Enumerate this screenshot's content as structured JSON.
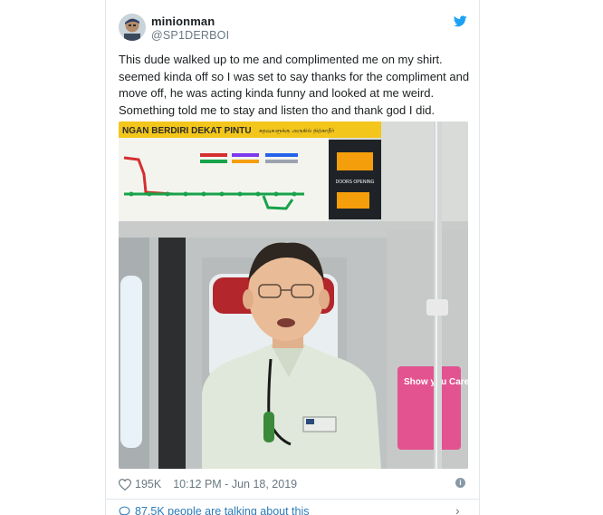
{
  "author": {
    "display_name": "minionman",
    "handle": "@SP1DERBOI"
  },
  "tweet": {
    "lines": [
      "This dude walked up to me and complimented me on my shirt.",
      "seemed kinda off so I was set to say thanks for the compliment and",
      "move off, he was acting kinda funny and looked at me weird.",
      "Something told me to stay and listen tho and thank god I did."
    ]
  },
  "photo": {
    "sign_text": "NGAN BERDIRI DEKAT PINTU",
    "sign_tamil": "கதவுகளுக்கு அருகில் நிற்காதீர்",
    "doors_label": "DOORS OPENING",
    "ad_text": "Show you Care"
  },
  "meta": {
    "likes": "195K",
    "timestamp": "10:12 PM - Jun 18, 2019"
  },
  "footer": {
    "talking": "87.5K people are talking about this"
  },
  "colors": {
    "twitter_blue": "#1da1f2",
    "link_blue": "#2b7bb9",
    "text": "#1c2022",
    "muted": "#697882"
  },
  "icons": {
    "logo": "twitter-bird-icon",
    "like": "heart-icon",
    "info": "info-icon",
    "conversation": "speech-bubble-icon",
    "expand": "chevron-right-icon"
  }
}
